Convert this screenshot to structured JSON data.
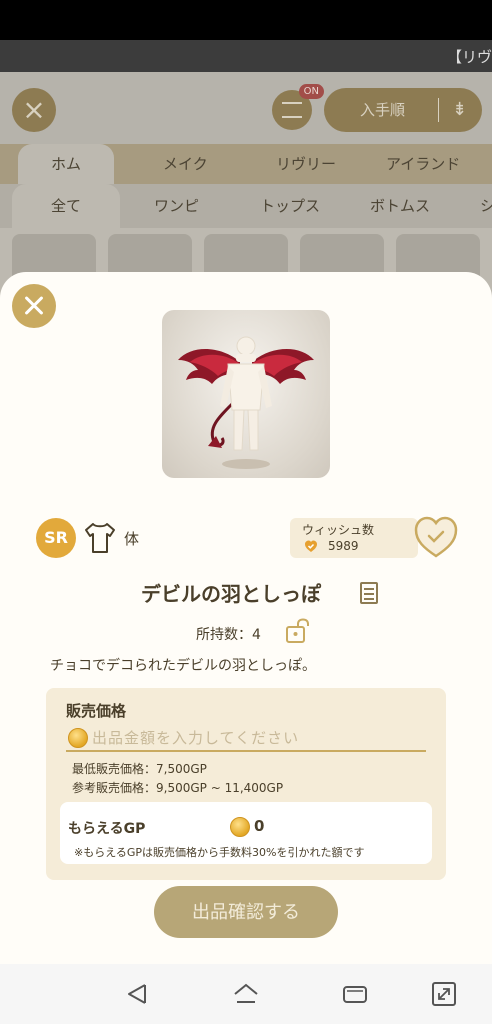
{
  "background": {
    "top_title": "【リヴ",
    "filter_badge": "ON",
    "sort_label": "入手順",
    "categories": [
      "ホム",
      "メイク",
      "リヴリー",
      "アイランド"
    ],
    "subcategories": [
      "全て",
      "ワンピ",
      "トップス",
      "ボトムス",
      "シ"
    ]
  },
  "item": {
    "rarity": "SR",
    "slot_icon": "shirt-icon",
    "slot_label": "体",
    "wish_label": "ウィッシュ数",
    "wish_count": "5989",
    "title": "デビルの羽としっぽ",
    "owned": "所持数：4",
    "description": "チョコでデコられたデビルの羽としっぽ。"
  },
  "price": {
    "label": "販売価格",
    "placeholder": "出品金額を入力してください",
    "min_price": "最低販売価格：7,500GP",
    "ref_price": "参考販売価格：9,500GP ~ 11,400GP",
    "gp_label": "もらえるGP",
    "gp_value": "0",
    "gp_note": "※もらえるGPは販売価格から手数料30%を引かれた額です"
  },
  "confirm_label": "出品確認する",
  "colors": {
    "accent": "#c9aa60",
    "panel": "#f5ecd8",
    "rarity": "#e2a93b",
    "button_disabled": "#b7a677"
  }
}
